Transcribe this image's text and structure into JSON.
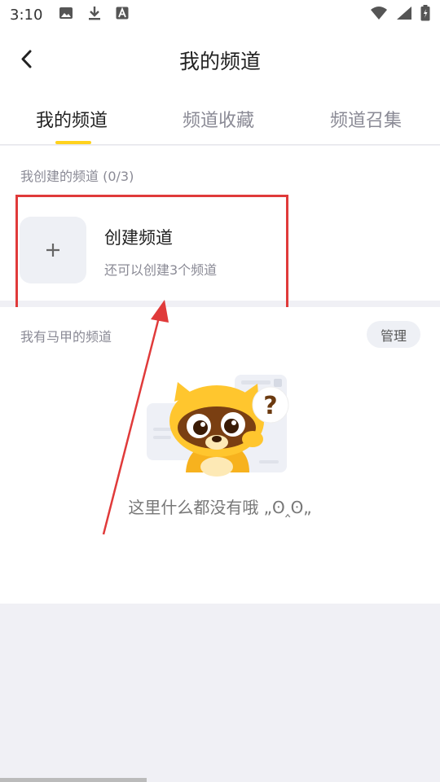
{
  "status_bar": {
    "time": "3:10"
  },
  "header": {
    "title": "我的频道"
  },
  "tabs": [
    {
      "label": "我的频道"
    },
    {
      "label": "频道收藏"
    },
    {
      "label": "频道召集"
    }
  ],
  "created_section": {
    "label": "我创建的频道 (0/3)",
    "create_title": "创建频道",
    "create_subtitle": "还可以创建3个频道"
  },
  "alias_section": {
    "label": "我有马甲的频道",
    "manage_label": "管理",
    "empty_text": "这里什么都没有哦 „ʘ‸ʘ„"
  },
  "colors": {
    "accent": "#ffd21e",
    "highlight": "#e03a3a"
  }
}
